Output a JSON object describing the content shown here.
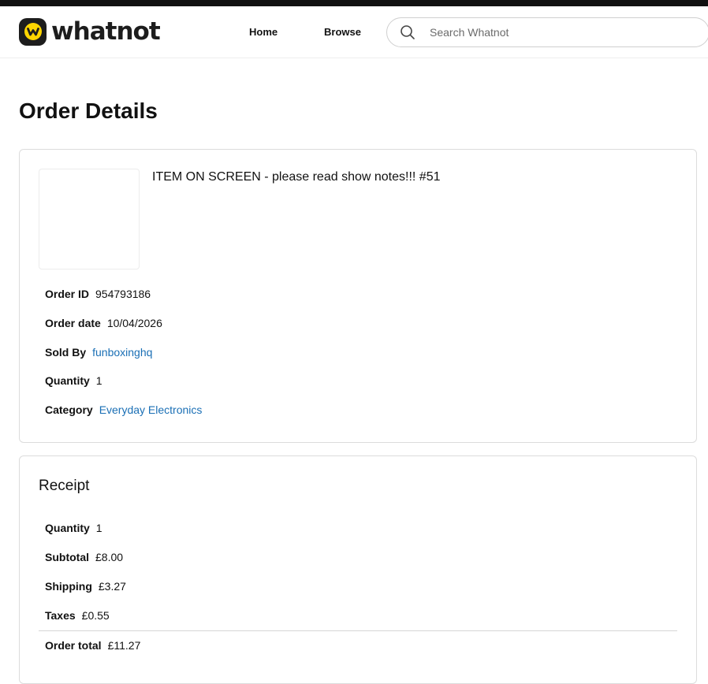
{
  "brand": {
    "name": "whatnot",
    "accent": "#FFD600"
  },
  "nav": {
    "home_label": "Home",
    "browse_label": "Browse"
  },
  "search": {
    "placeholder": "Search Whatnot"
  },
  "page": {
    "title": "Order Details"
  },
  "order": {
    "item_title": "ITEM ON SCREEN - please read show notes!!! #51",
    "fields": {
      "order_id": {
        "label": "Order ID",
        "value": "954793186"
      },
      "order_date": {
        "label": "Order date",
        "value": "10/04/2026"
      },
      "sold_by": {
        "label": "Sold By",
        "value": "funboxinghq"
      },
      "quantity": {
        "label": "Quantity",
        "value": "1"
      },
      "category": {
        "label": "Category",
        "value": "Everyday Electronics"
      }
    }
  },
  "receipt": {
    "title": "Receipt",
    "fields": {
      "quantity": {
        "label": "Quantity",
        "value": "1"
      },
      "subtotal": {
        "label": "Subtotal",
        "value": "£8.00"
      },
      "shipping": {
        "label": "Shipping",
        "value": "£3.27"
      },
      "taxes": {
        "label": "Taxes",
        "value": "£0.55"
      },
      "total": {
        "label": "Order total",
        "value": "£11.27"
      }
    }
  },
  "colors": {
    "link": "#1a6fb5",
    "text": "#111111",
    "border": "#dcdcdc"
  },
  "icons": {
    "search": "search-icon",
    "logo": "whatnot-logo-icon"
  }
}
